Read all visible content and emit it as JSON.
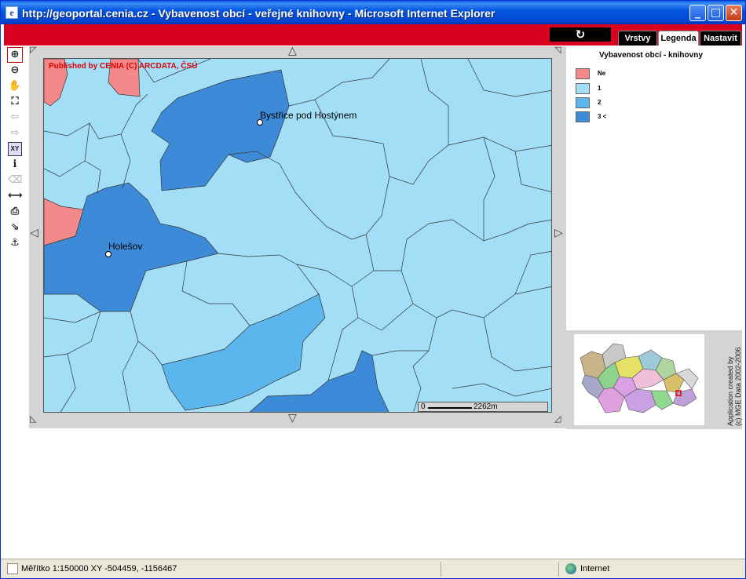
{
  "window": {
    "title": "http://geoportal.cenia.cz - Vybavenost obcí - veřejné knihovny - Microsoft Internet Explorer",
    "minimize": "_",
    "maximize": "□",
    "close": "✕"
  },
  "header": {
    "refresh_glyph": "↻",
    "tabs": [
      {
        "label": "Vrstvy",
        "active": false
      },
      {
        "label": "Legenda",
        "active": true
      },
      {
        "label": "Nastavit",
        "active": false
      }
    ]
  },
  "toolbar": {
    "tools": [
      {
        "name": "zoom-in",
        "glyph": "⊕",
        "active": true
      },
      {
        "name": "zoom-out",
        "glyph": "⊖",
        "active": false
      },
      {
        "name": "pan",
        "glyph": "✋",
        "active": false
      },
      {
        "name": "full-extent",
        "glyph": "⛶",
        "active": false
      },
      {
        "name": "back",
        "glyph": "⇦",
        "disabled": true
      },
      {
        "name": "forward",
        "glyph": "⇨",
        "disabled": true
      },
      {
        "name": "coordinates",
        "glyph": "XY",
        "active": false
      },
      {
        "name": "identify",
        "glyph": "ℹ",
        "active": false
      },
      {
        "name": "erase",
        "glyph": "⌫",
        "disabled": true
      },
      {
        "name": "measure",
        "glyph": "⟷",
        "active": false
      },
      {
        "name": "print",
        "glyph": "⎙",
        "active": false
      },
      {
        "name": "export",
        "glyph": "⇘",
        "active": false
      },
      {
        "name": "anchor",
        "glyph": "⚓",
        "active": false
      }
    ]
  },
  "map": {
    "copyright": "Published by CENIA     (C) ARCDATA, ČSÚ",
    "places": [
      {
        "name": "Bystřice pod Hostýnem"
      },
      {
        "name": "Holešov"
      }
    ],
    "scale": {
      "zero": "0",
      "distance": "2262m"
    },
    "pan_arrows": {
      "up": "△",
      "down": "▽",
      "left": "◁",
      "right": "▷"
    }
  },
  "legend": {
    "title": "Vybavenost obcí - knihovny",
    "items": [
      {
        "label": "Ne",
        "color": "#f4898b"
      },
      {
        "label": "1",
        "color": "#a2dff7"
      },
      {
        "label": "2",
        "color": "#5bb6ee"
      },
      {
        "label": "3 <",
        "color": "#3d8bd8"
      }
    ]
  },
  "overview": {
    "credits_line1": "Application created by",
    "credits_line2": "(c) MGE Data 2002-2006"
  },
  "statusbar": {
    "text": "Měřítko 1:150000        XY -504459, -1156467",
    "zone": "Internet"
  },
  "colors": {
    "header_red": "#d8001e",
    "muni_none": "#f4898b",
    "muni_1": "#a2dff7",
    "muni_2": "#5bb6ee",
    "muni_3plus": "#3d8bd8"
  }
}
